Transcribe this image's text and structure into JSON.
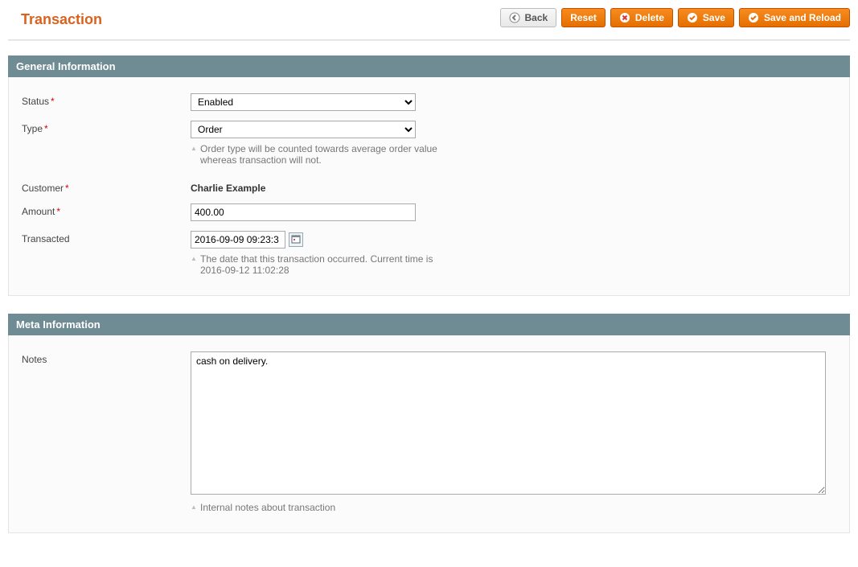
{
  "page": {
    "title": "Transaction"
  },
  "buttons": {
    "back": "Back",
    "reset": "Reset",
    "delete": "Delete",
    "save": "Save",
    "save_reload": "Save and Reload"
  },
  "sections": {
    "general": {
      "title": "General Information",
      "status_label": "Status",
      "status_value": "Enabled",
      "type_label": "Type",
      "type_value": "Order",
      "type_hint": "Order type will be counted towards average order value whereas transaction will not.",
      "customer_label": "Customer",
      "customer_value": "Charlie Example",
      "amount_label": "Amount",
      "amount_value": "400.00",
      "transacted_label": "Transacted",
      "transacted_value": "2016-09-09 09:23:3",
      "transacted_hint": "The date that this transaction occurred. Current time is 2016-09-12 11:02:28"
    },
    "meta": {
      "title": "Meta Information",
      "notes_label": "Notes",
      "notes_value": "cash on delivery.",
      "notes_hint": "Internal notes about transaction"
    }
  }
}
